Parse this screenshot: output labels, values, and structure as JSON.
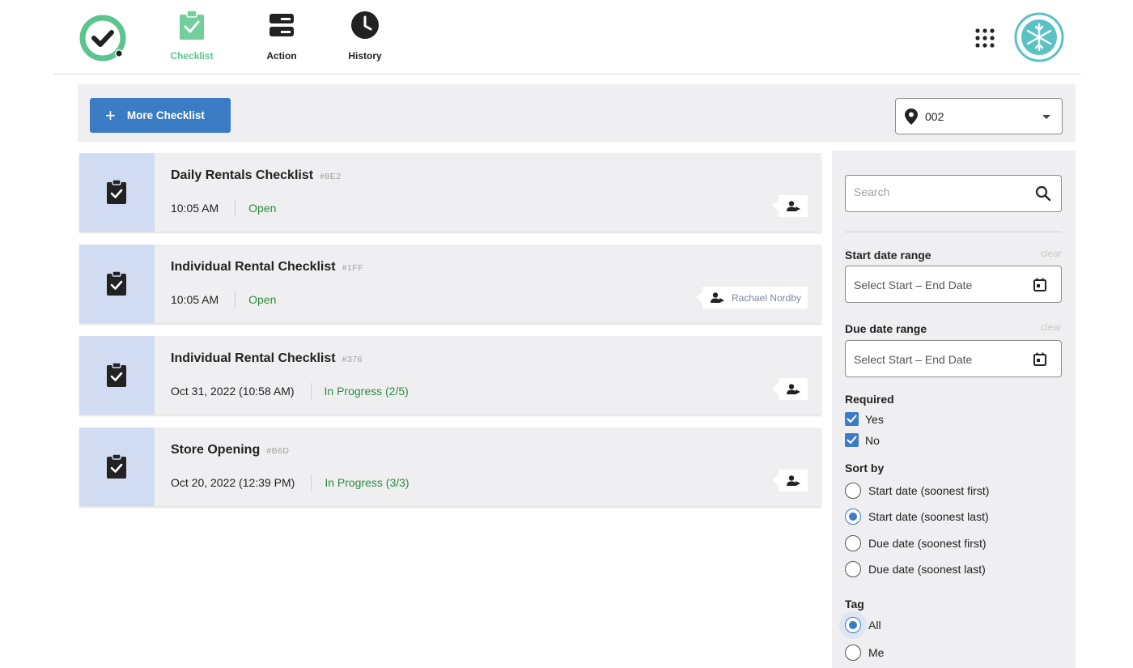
{
  "nav": {
    "items": [
      {
        "label": "Checklist",
        "icon": "clipboard-check-icon",
        "active": true
      },
      {
        "label": "Action",
        "icon": "server-icon"
      },
      {
        "label": "History",
        "icon": "clock-icon"
      }
    ]
  },
  "toolbar": {
    "more_label": "More Checklist",
    "location_value": "002"
  },
  "checklists": [
    {
      "title": "Daily Rentals Checklist",
      "code": "#8E2",
      "time": "10:05 AM",
      "status": "Open",
      "assignee": ""
    },
    {
      "title": "Individual Rental Checklist",
      "code": "#1FF",
      "time": "10:05 AM",
      "status": "Open",
      "assignee": "Rachael Nordby"
    },
    {
      "title": "Individual Rental Checklist",
      "code": "#376",
      "time": "Oct 31, 2022 (10:58 AM)",
      "status": "In Progress (2/5)",
      "assignee": ""
    },
    {
      "title": "Store Opening",
      "code": "#B6D",
      "time": "Oct 20, 2022 (12:39 PM)",
      "status": "In Progress (3/3)",
      "assignee": ""
    }
  ],
  "filters": {
    "search_placeholder": "Search",
    "start_range": {
      "label": "Start date range",
      "clear": "clear",
      "placeholder": "Select Start  – End Date"
    },
    "due_range": {
      "label": "Due date range",
      "clear": "clear",
      "placeholder": "Select Start  – End Date"
    },
    "required": {
      "label": "Required",
      "options": [
        {
          "label": "Yes",
          "checked": true
        },
        {
          "label": "No",
          "checked": true
        }
      ]
    },
    "sort": {
      "label": "Sort by",
      "options": [
        {
          "label": "Start date (soonest first)",
          "selected": false
        },
        {
          "label": "Start date (soonest last)",
          "selected": true
        },
        {
          "label": "Due date (soonest first)",
          "selected": false
        },
        {
          "label": "Due date (soonest last)",
          "selected": false
        }
      ]
    },
    "tag": {
      "label": "Tag",
      "options": [
        {
          "label": "All",
          "selected": true
        },
        {
          "label": "Me",
          "selected": false
        }
      ]
    }
  },
  "colors": {
    "accent": "#3c7cc4",
    "brand_green": "#5cc48e",
    "status_green": "#2e8b3f",
    "strip": "#d1dcf2",
    "panel": "#efeff1"
  }
}
